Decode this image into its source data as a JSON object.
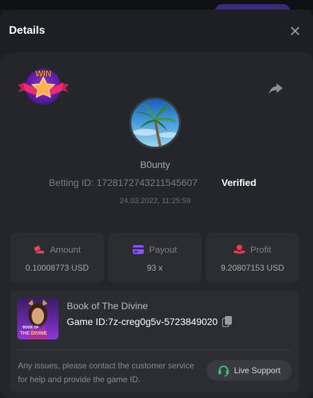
{
  "modal": {
    "title": "Details"
  },
  "badge": {
    "text": "WIN",
    "icon": "win-star-badge"
  },
  "player": {
    "username": "B0unty",
    "betting_id": "Betting ID: 1728172743211545607",
    "verified": "Verified",
    "timestamp": "24.03.2022, 11:25:59"
  },
  "stats": {
    "amount": {
      "label": "Amount",
      "value": "0.10008773 USD",
      "icon": "amount-icon",
      "color": "#e8455d"
    },
    "payout": {
      "label": "Payout",
      "value": "93 x",
      "icon": "payout-icon",
      "color": "#8b52f5"
    },
    "profit": {
      "label": "Profit",
      "value": "9.20807153 USD",
      "icon": "profit-icon",
      "color": "#e53e4b"
    }
  },
  "game": {
    "name": "Book of The Divine",
    "game_id": "Game ID:7z-creg0g5v-5723849020",
    "thumb_text_top": "BOOK OF",
    "thumb_text_bottom": "THE DIVINE"
  },
  "support": {
    "message": "Any issues, please contact the customer service for help and provide the game ID.",
    "button": "Live Support",
    "accent": "#3cc26a"
  }
}
